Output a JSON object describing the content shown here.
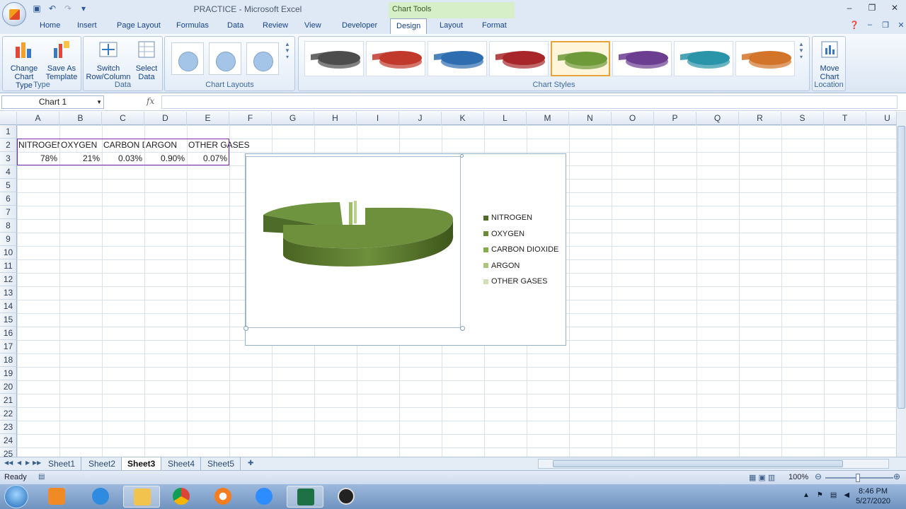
{
  "window": {
    "title": "PRACTICE - Microsoft Excel",
    "contextual_tab_group": "Chart Tools",
    "controls": [
      "–",
      "❐",
      "✕"
    ]
  },
  "tabs": [
    "Home",
    "Insert",
    "Page Layout",
    "Formulas",
    "Data",
    "Review",
    "View",
    "Developer",
    "Design",
    "Layout",
    "Format"
  ],
  "active_tab": "Design",
  "ribbon": {
    "type_group": {
      "label": "Type",
      "change_chart_type": [
        "Change",
        "Chart Type"
      ],
      "save_as_template": [
        "Save As",
        "Template"
      ]
    },
    "data_group": {
      "label": "Data",
      "switch_row_column": [
        "Switch",
        "Row/Column"
      ],
      "select_data": [
        "Select",
        "Data"
      ]
    },
    "layouts_group": {
      "label": "Chart Layouts"
    },
    "styles_group": {
      "label": "Chart Styles",
      "styles": [
        "#4d4d4d",
        "#c0392b",
        "#2e6db0",
        "#a8262a",
        "#6e9a3a",
        "#6b3e92",
        "#2a94a8",
        "#d2752a"
      ],
      "selected_index": 4
    },
    "location_group": {
      "label": "Location",
      "move_chart": [
        "Move",
        "Chart"
      ]
    }
  },
  "formula_bar": {
    "name_box": "Chart 1",
    "fx": "fx",
    "value": ""
  },
  "columns": [
    "A",
    "B",
    "C",
    "D",
    "E",
    "F",
    "G",
    "H",
    "I",
    "J",
    "K",
    "L",
    "M",
    "N",
    "O",
    "P",
    "Q",
    "R",
    "S",
    "T",
    "U"
  ],
  "rows": [
    "1",
    "2",
    "3",
    "4",
    "5",
    "6",
    "7",
    "8",
    "9",
    "10",
    "11",
    "12",
    "13",
    "14",
    "15",
    "16",
    "17",
    "18",
    "19",
    "20",
    "21",
    "22",
    "23",
    "24",
    "25"
  ],
  "cells": {
    "A2": "NITROGEN",
    "B2": "OXYGEN",
    "C2": "CARBON DIOXIDE",
    "D2": "ARGON",
    "E2": "OTHER GASES",
    "A3": "78%",
    "B3": "21%",
    "C3": "0.03%",
    "D3": "0.90%",
    "E3": "0.07%"
  },
  "chart": {
    "legend": [
      "NITROGEN",
      "OXYGEN",
      "CARBON DIOXIDE",
      "ARGON",
      "OTHER GASES"
    ],
    "legend_colors": [
      "#4f6b2a",
      "#6a8d38",
      "#86ad4c",
      "#a9c67a",
      "#d0dfb6"
    ],
    "slice_color": "#6e8f3c"
  },
  "sheets": [
    "Sheet1",
    "Sheet2",
    "Sheet3",
    "Sheet4",
    "Sheet5"
  ],
  "active_sheet": "Sheet3",
  "status": {
    "mode": "Ready",
    "zoom": "100%"
  },
  "taskbar": {
    "time": "8:46 PM",
    "date": "5/27/2020",
    "apps": [
      "media-player",
      "internet-explorer",
      "file-explorer",
      "chrome",
      "firefox-like",
      "zoom",
      "excel",
      "obs"
    ]
  }
}
